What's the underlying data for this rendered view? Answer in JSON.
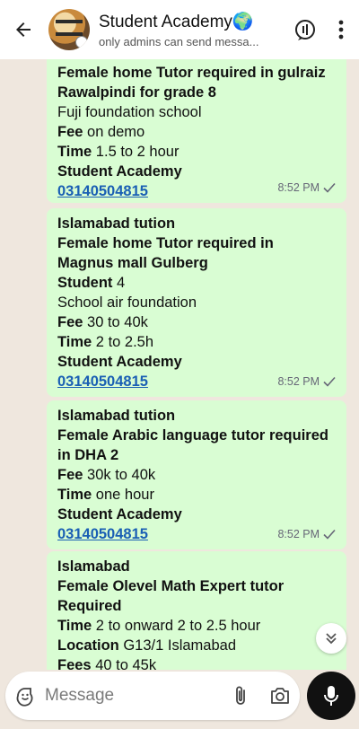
{
  "header": {
    "title": "Student Academy🌍",
    "subtitle": "only admins can send messa..."
  },
  "messages": [
    {
      "lines": [
        {
          "bold": "Female home Tutor required in gulraiz"
        },
        {
          "bold": "Rawalpindi for grade 8"
        },
        {
          "text": "Fuji foundation school"
        },
        {
          "bold": "Fee",
          "text": " on demo"
        },
        {
          "bold": "Time",
          "text": " 1.5 to 2 hour"
        },
        {
          "bold": "Student Academy"
        }
      ],
      "phone": " 03140504815",
      "time": "8:52 PM"
    },
    {
      "lines": [
        {
          "bold": "Islamabad tution"
        },
        {
          "bold": "Female home Tutor required in"
        },
        {
          "bold": "Magnus mall Gulberg"
        },
        {
          "bold": "Student",
          "text": " 4"
        },
        {
          "text": "School air foundation"
        },
        {
          "bold": "Fee",
          "text": " 30 to 40k"
        },
        {
          "bold": "Time",
          "text": " 2 to 2.5h"
        },
        {
          "bold": "Student Academy"
        }
      ],
      "phone": "03140504815",
      "time": "8:52 PM"
    },
    {
      "lines": [
        {
          "bold": "Islamabad tution"
        },
        {
          "bold": "Female Arabic language tutor required"
        },
        {
          "bold": "in DHA 2"
        },
        {
          "bold": "Fee",
          "text": " 30k to 40k"
        },
        {
          "bold": "Time",
          "text": " one hour"
        },
        {
          "bold": "Student Academy"
        }
      ],
      "phone": "03140504815",
      "time": "8:52 PM"
    },
    {
      "lines": [
        {
          "bold": "Islamabad"
        },
        {
          "bold": "Female Olevel Math Expert tutor"
        },
        {
          "bold": "Required"
        },
        {
          "bold": "Time",
          "text": " 2 to onward 2 to 2.5 hour"
        },
        {
          "bold": "Location",
          "text": " G13/1 Islamabad"
        },
        {
          "bold": "Fees",
          "text": " 40 to 45k"
        }
      ]
    }
  ],
  "composer": {
    "placeholder": "Message"
  },
  "icons": {
    "back": "back-arrow-icon",
    "call": "call-group-icon",
    "more": "more-vert-icon",
    "emoji": "sticker-emoji-icon",
    "attach": "paperclip-icon",
    "camera": "camera-icon",
    "mic": "microphone-icon",
    "scroll": "double-chevron-down-icon",
    "read": "check-icon"
  },
  "colors": {
    "bubble": "#d9fdd3",
    "chat_bg": "#efe7de",
    "link": "#1a5fb4"
  }
}
